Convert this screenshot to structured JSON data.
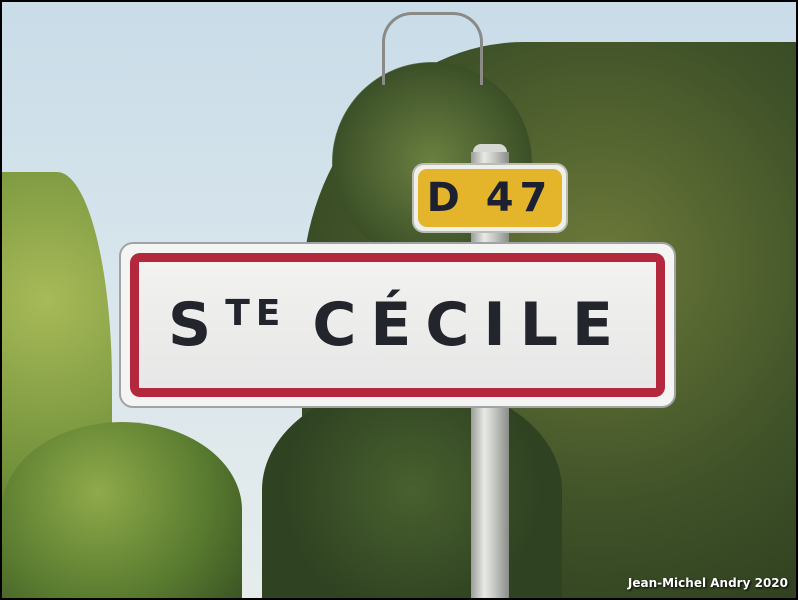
{
  "sign": {
    "prefix_main": "S",
    "prefix_sup": "TE",
    "name": "CÉCILE",
    "colors": {
      "border": "#b3283c",
      "background": "#f2f2f0",
      "text": "#23252d"
    }
  },
  "road_plate": {
    "label": "D 47",
    "color": "#e4b52a"
  },
  "credit": "Jean-Michel Andry 2020"
}
